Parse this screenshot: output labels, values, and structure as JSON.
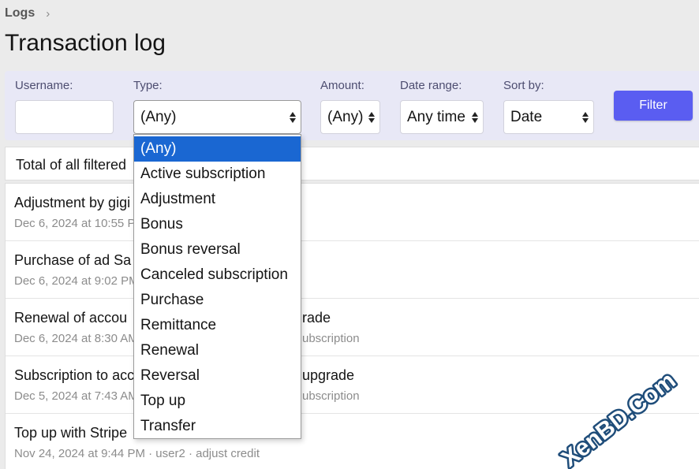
{
  "breadcrumb": {
    "label": "Logs",
    "separator": "›"
  },
  "page_title": "Transaction log",
  "filters": {
    "username_label": "Username:",
    "username_value": "",
    "type_label": "Type:",
    "type_value": "(Any)",
    "amount_label": "Amount:",
    "amount_value": "(Any)",
    "date_label": "Date range:",
    "date_value": "Any time",
    "sort_label": "Sort by:",
    "sort_value": "Date",
    "button_label": "Filter",
    "button_color": "#5a5df1"
  },
  "total_text": "Total of all filtered",
  "type_options": [
    "(Any)",
    "Active subscription",
    "Adjustment",
    "Bonus",
    "Bonus reversal",
    "Canceled subscription",
    "Purchase",
    "Remittance",
    "Renewal",
    "Reversal",
    "Top up",
    "Transfer"
  ],
  "selected_option_color": "#1a67d2",
  "rows": [
    {
      "title": "Adjustment by gigi",
      "title_tail": "",
      "meta": "Dec 6, 2024 at 10:55 P",
      "meta_tail": ""
    },
    {
      "title": "Purchase of ad Sa",
      "title_tail": "",
      "meta": "Dec 6, 2024 at 9:02 PM",
      "meta_tail": ""
    },
    {
      "title": "Renewal of accou",
      "title_tail": "rade",
      "meta": "Dec 6, 2024 at 8:30 AM",
      "meta_tail": "ubscription"
    },
    {
      "title": "Subscription to acc",
      "title_tail": "upgrade",
      "meta": "Dec 5, 2024 at 7:43 AM",
      "meta_tail": "ubscription"
    },
    {
      "title": "Top up with Stripe",
      "title_tail": "",
      "meta": "Nov 24, 2024 at 9:44 PM · user2 · adjust credit",
      "meta_tail": ""
    }
  ],
  "watermark": {
    "text": "XenBD.Com",
    "color": "#1f4d7a"
  }
}
